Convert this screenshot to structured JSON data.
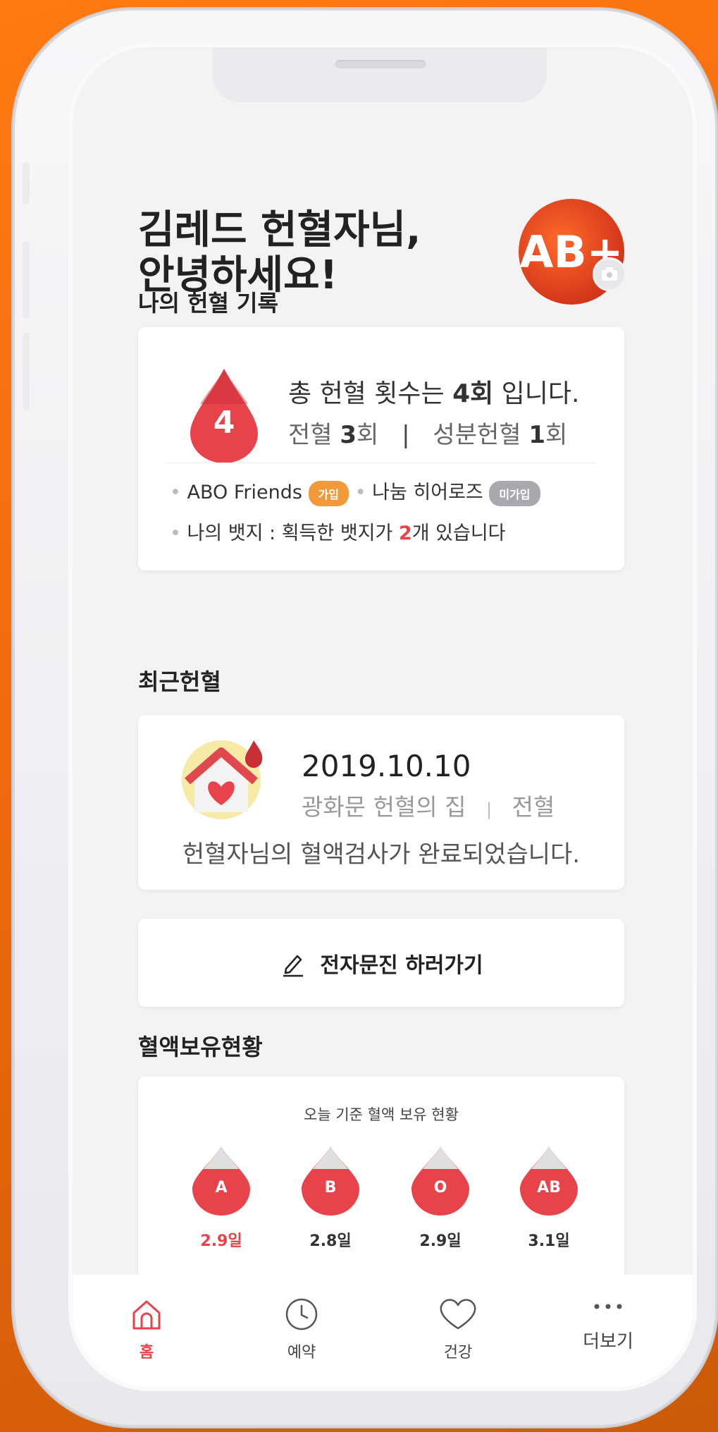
{
  "header": {
    "greeting_line1": "김레드 헌혈자님,",
    "greeting_line2": "안녕하세요!",
    "blood_type_badge": "AB+",
    "camera_icon": "camera-icon"
  },
  "record": {
    "section_title": "나의 헌혈 기록",
    "count": "4",
    "total_prefix": "총 헌혈 횟수는 ",
    "total_value": "4회",
    "total_suffix": " 입니다.",
    "whole_label": "전혈 ",
    "whole_value": "3",
    "whole_unit": "회",
    "divider": "|",
    "component_label": "성분헌혈 ",
    "component_value": "1",
    "component_unit": "회",
    "abo_friends_label": "ABO Friends",
    "abo_friends_status": "가입",
    "heroes_label": "나눔 히어로즈",
    "heroes_status": "미가입",
    "badge_prefix": "나의 뱃지 : 획득한 뱃지가 ",
    "badge_count": "2",
    "badge_suffix": "개 있습니다"
  },
  "recent": {
    "section_title": "최근헌혈",
    "date": "2019.10.10",
    "place": "광화문 헌혈의 집",
    "separator": "|",
    "type": "전혈",
    "message": "헌혈자님의 혈액검사가 완료되었습니다."
  },
  "questionnaire": {
    "label": "전자문진 하러가기",
    "icon": "pencil-icon"
  },
  "stock": {
    "section_title": "혈액보유현황",
    "subtitle": "오늘 기준 혈액 보유 현황",
    "items": [
      {
        "type": "A",
        "days": "2.9일",
        "highlight": true
      },
      {
        "type": "B",
        "days": "2.8일",
        "highlight": false
      },
      {
        "type": "O",
        "days": "2.9일",
        "highlight": false
      },
      {
        "type": "AB",
        "days": "3.1일",
        "highlight": false
      }
    ]
  },
  "nav": {
    "items": [
      {
        "label": "홈",
        "icon": "home-icon",
        "active": true
      },
      {
        "label": "예약",
        "icon": "clock-icon",
        "active": false
      },
      {
        "label": "건강",
        "icon": "heart-icon",
        "active": false
      },
      {
        "label": "더보기",
        "icon": "more-icon",
        "active": false
      }
    ]
  },
  "colors": {
    "accent": "#e8434b",
    "background": "#f3f3f4",
    "frame_orange": "#f06a0c"
  }
}
